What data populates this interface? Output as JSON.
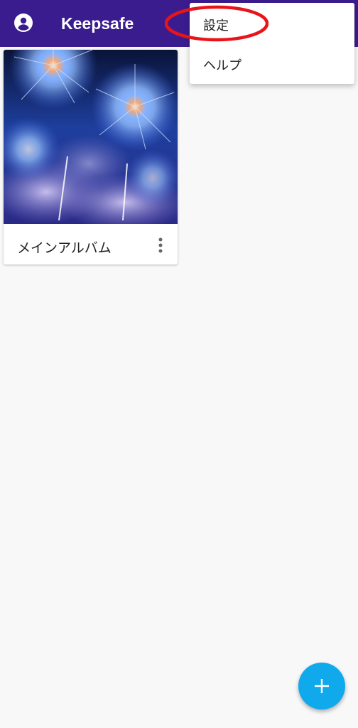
{
  "appbar": {
    "title": "Keepsafe",
    "account_icon": "account-circle-icon",
    "color": "#3b1c8e"
  },
  "album": {
    "label": "メインアルバム",
    "thumbnail": "fireworks-photo",
    "more_icon": "more-vertical-icon"
  },
  "menu": {
    "items": [
      {
        "label": "設定"
      },
      {
        "label": "ヘルプ"
      }
    ]
  },
  "annotation": {
    "color": "#e8141a"
  },
  "fab": {
    "icon": "plus-icon",
    "color": "#10a9ec"
  }
}
